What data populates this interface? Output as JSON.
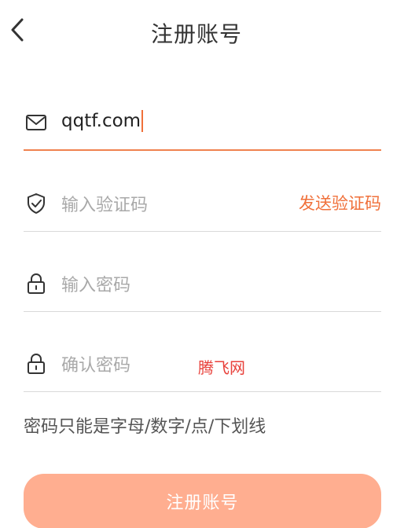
{
  "header": {
    "title": "注册账号",
    "back_icon": "chevron-left-icon"
  },
  "form": {
    "email": {
      "icon": "mail-icon",
      "value": "qqtf.com"
    },
    "code": {
      "icon": "shield-check-icon",
      "placeholder": "输入验证码",
      "send_label": "发送验证码"
    },
    "password": {
      "icon": "lock-icon",
      "placeholder": "输入密码"
    },
    "confirm_password": {
      "icon": "lock-icon",
      "placeholder": "确认密码"
    },
    "hint": "密码只能是字母/数字/点/下划线",
    "submit_label": "注册账号"
  },
  "watermark": "腾飞网",
  "colors": {
    "accent": "#f0703a",
    "active_underline": "#f0824f",
    "button_bg": "#ffae90",
    "divider": "#d9d9d9",
    "watermark": "#e8403a"
  }
}
